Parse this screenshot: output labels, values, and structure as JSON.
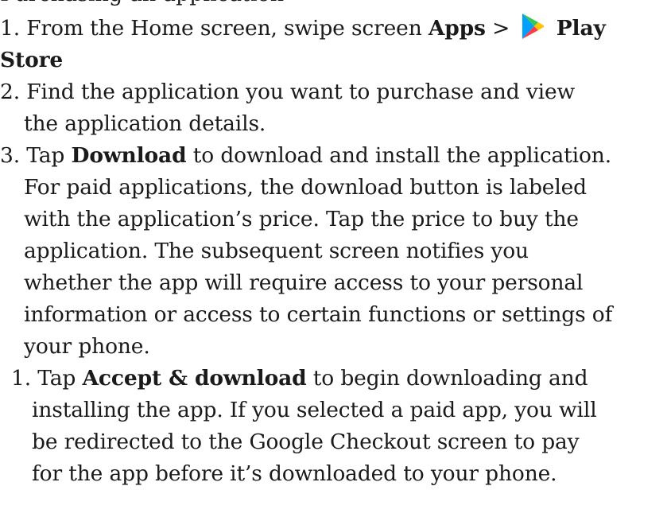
{
  "document": {
    "cut_heading": "Purchasing an application",
    "step1": {
      "number": "1.",
      "text_pre": "From the Home screen, swipe screen",
      "apps": "Apps",
      "sep": ">",
      "play": "Play",
      "store": "Store",
      "icon": "google-play-icon"
    },
    "step2": {
      "line1": "2. Find the application you want to purchase and view",
      "line2": "the application details."
    },
    "step3": {
      "number": "3. Tap",
      "download": "Download",
      "line1_post": "to download and install the application.",
      "line2": "For paid applications, the download button is labeled",
      "line3": "with the application’s price. Tap the price to buy the",
      "line4": "application. The subsequent screen notifies you",
      "line5": "whether the app will require access to your personal",
      "line6": "information or access to certain functions or settings of",
      "line7": "your phone."
    },
    "substep1": {
      "number": "1. Tap",
      "accept": "Accept & download",
      "line1_post": "to begin downloading and",
      "line2": "installing the app. If you selected a paid app, you will",
      "line3": "be redirected to the Google Checkout screen to pay",
      "line4": "for the app before it’s downloaded to your phone."
    }
  }
}
